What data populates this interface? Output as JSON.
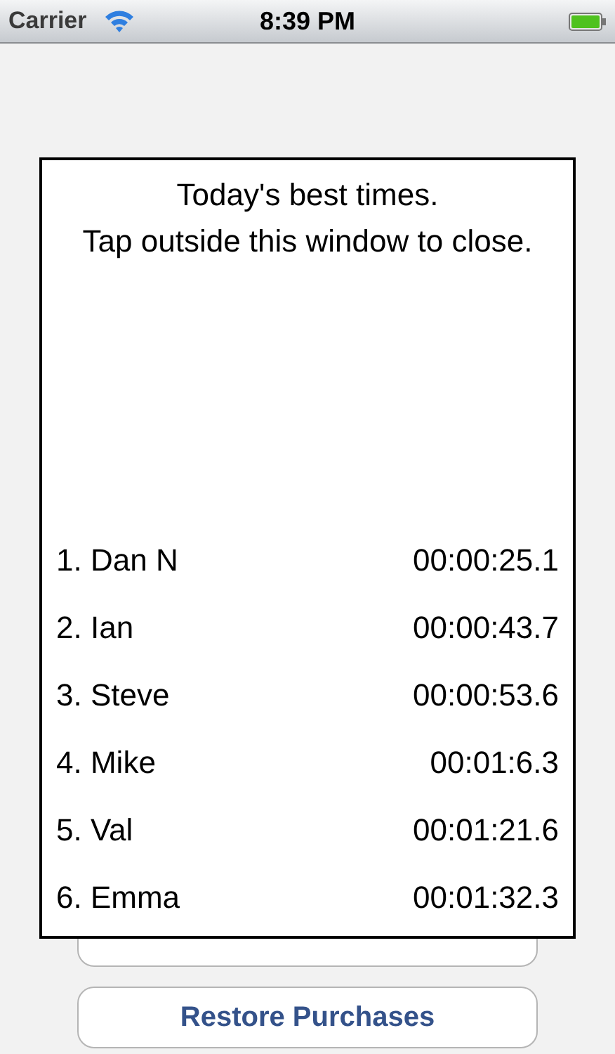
{
  "status_bar": {
    "carrier": "Carrier",
    "time": "8:39 PM"
  },
  "buttons": [
    {
      "kind": "covered"
    },
    {
      "kind": "plain",
      "label": "Restore Purchases"
    }
  ],
  "popup": {
    "title_lines": [
      "Today's best times.",
      "Tap outside this window to close."
    ],
    "rows": [
      {
        "rank": "1.",
        "name": "Dan N",
        "time": "00:00:25.1"
      },
      {
        "rank": "2.",
        "name": "Ian",
        "time": "00:00:43.7"
      },
      {
        "rank": "3.",
        "name": "Steve",
        "time": "00:00:53.6"
      },
      {
        "rank": "4.",
        "name": "Mike",
        "time": "00:01:6.3"
      },
      {
        "rank": "5.",
        "name": "Val",
        "time": "00:01:21.6"
      },
      {
        "rank": "6.",
        "name": "Emma",
        "time": "00:01:32.3"
      }
    ]
  }
}
